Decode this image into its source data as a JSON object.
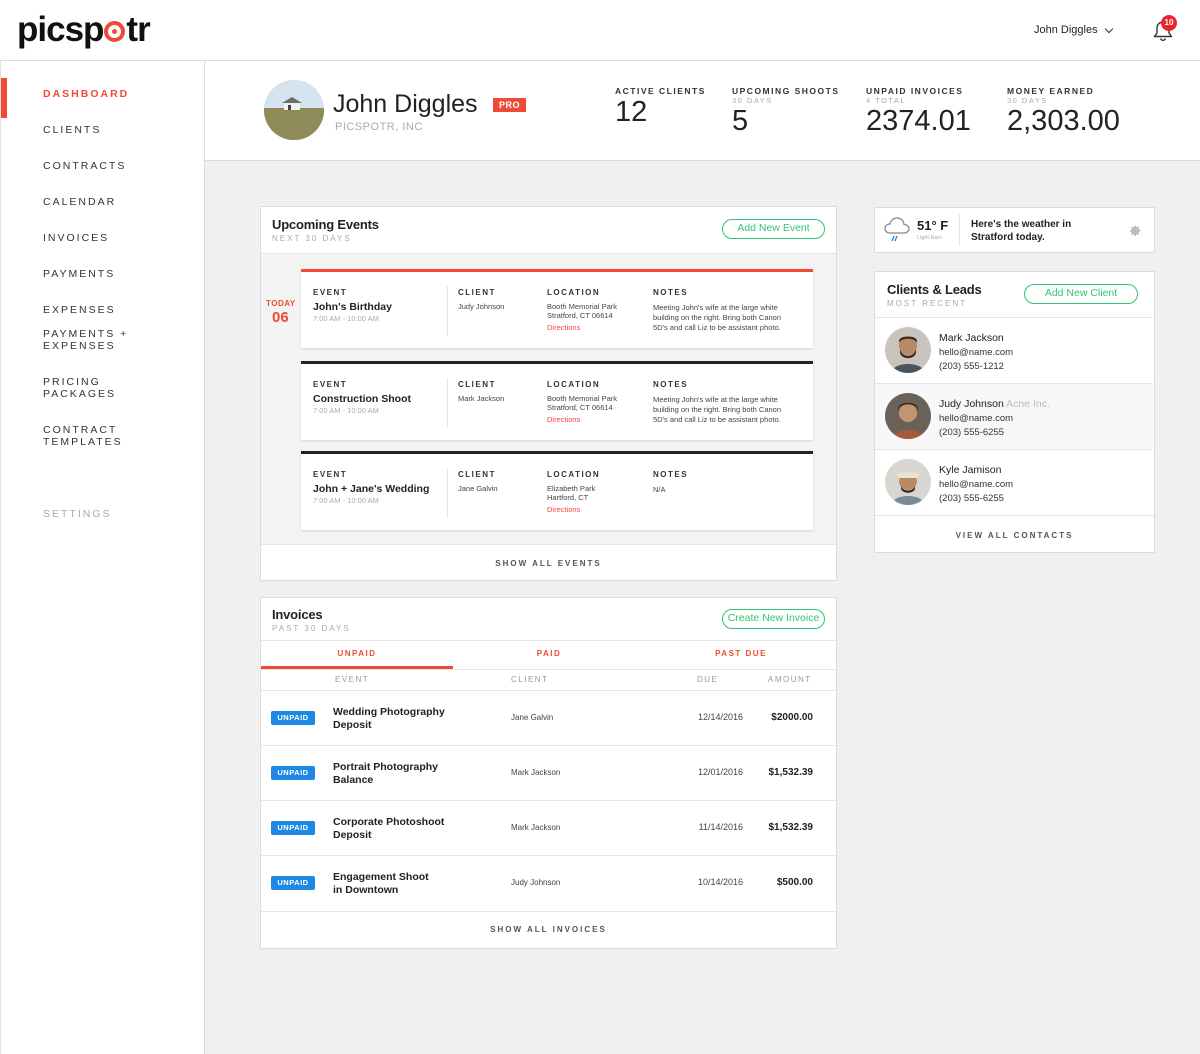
{
  "app": {
    "logo": {
      "pre": "picsp",
      "post": "tr"
    },
    "user_menu_label": "John Diggles",
    "notification_count": "10"
  },
  "colors": {
    "accent": "#ef4a36",
    "green": "#2ec76d",
    "unpaid_blue": "#1e88e5"
  },
  "sidebar": {
    "items": [
      {
        "label": "DASHBOARD",
        "active": true
      },
      {
        "label": "CLIENTS"
      },
      {
        "label": "CONTRACTS"
      },
      {
        "label": "CALENDAR"
      },
      {
        "label": "INVOICES"
      },
      {
        "label": "PAYMENTS"
      },
      {
        "label": "EXPENSES"
      },
      {
        "label_line1": "PAYMENTS +",
        "label_line2": "EXPENSES"
      },
      {
        "label_line1": "PRICING",
        "label_line2": "PACKAGES"
      },
      {
        "label_line1": "CONTRACT",
        "label_line2": "TEMPLATES"
      },
      {
        "label": "SETTINGS",
        "muted": true
      }
    ]
  },
  "profile": {
    "name": "John Diggles",
    "badge": "PRO",
    "company": "PICSPOTR, INC"
  },
  "stats": [
    {
      "label": "ACTIVE CLIENTS",
      "sub": "",
      "value": "12"
    },
    {
      "label": "UPCOMING SHOOTS",
      "sub": "30 DAYS",
      "value": "5"
    },
    {
      "label": "UNPAID INVOICES",
      "sub": "4 TOTAL",
      "value": "2374.01"
    },
    {
      "label": "MONEY EARNED",
      "sub": "30 DAYS",
      "value": "2,303.00"
    }
  ],
  "events": {
    "title": "Upcoming Events",
    "subtitle": "NEXT 30 DAYS",
    "add_button": "Add New Event",
    "today_label": "TODAY",
    "today_day": "06",
    "col_event": "EVENT",
    "col_client": "CLIENT",
    "col_location": "LOCATION",
    "col_notes": "NOTES",
    "items": [
      {
        "title": "John's Birthday",
        "time": "7:00 AM - 10:00 AM",
        "client": "Judy Johnson",
        "location_line1": "Booth Memorial Park",
        "location_line2": "Stratford, CT 06614",
        "directions": "Directions",
        "notes_line1": "Meeting John's wife at the large white",
        "notes_line2": "building on the right. Bring both Canon",
        "notes_line3": "5D's and call Liz to be assistant photo."
      },
      {
        "title": "Construction Shoot",
        "time": "7:00 AM - 10:00 AM",
        "client": "Mark Jackson",
        "location_line1": "Booth Memorial Park",
        "location_line2": "Stratford, CT 06614",
        "directions": "Directions",
        "notes_line1": "Meeting John's wife at the large white",
        "notes_line2": "building on the right. Bring both Canon",
        "notes_line3": "5D's and call Liz to be assistant photo."
      },
      {
        "title": "John + Jane's Wedding",
        "time": "7:00 AM - 10:00 AM",
        "client": "Jane Galvin",
        "location_line1": "Elizabeth Park",
        "location_line2": "Hartford, CT",
        "directions": "Directions",
        "notes_line1": "N/A",
        "notes_line2": "",
        "notes_line3": ""
      }
    ],
    "show_all": "SHOW ALL EVENTS"
  },
  "invoices": {
    "title": "Invoices",
    "subtitle": "PAST 30 DAYS",
    "create_button": "Create New Invoice",
    "tabs": [
      "UNPAID",
      "PAID",
      "PAST DUE"
    ],
    "headers": {
      "event": "EVENT",
      "client": "CLIENT",
      "due": "DUE",
      "amount": "AMOUNT"
    },
    "rows": [
      {
        "status": "UNPAID",
        "event_line1": "Wedding Photography",
        "event_line2": "Deposit",
        "client": "Jane Galvin",
        "due": "12/14/2016",
        "amount": "$2000.00"
      },
      {
        "status": "UNPAID",
        "event_line1": "Portrait Photography",
        "event_line2": "Balance",
        "client": "Mark Jackson",
        "due": "12/01/2016",
        "amount": "$1,532.39"
      },
      {
        "status": "UNPAID",
        "event_line1": "Corporate Photoshoot",
        "event_line2": "Deposit",
        "client": "Mark Jackson",
        "due": "11/14/2016",
        "amount": "$1,532.39"
      },
      {
        "status": "UNPAID",
        "event_line1": "Engagement Shoot",
        "event_line2": "in Downtown",
        "client": "Judy Johnson",
        "due": "10/14/2016",
        "amount": "$500.00"
      }
    ],
    "show_all": "SHOW ALL INVOICES"
  },
  "weather": {
    "temp": "51° F",
    "condition": "Light Rain",
    "message_line1": "Here's the weather in",
    "message_line2": "Stratford today.",
    "icon": "cloud-rain-icon"
  },
  "clients": {
    "title": "Clients & Leads",
    "subtitle": "MOST RECENT",
    "add_button": "Add New Client",
    "items": [
      {
        "name": "Mark Jackson",
        "company": "",
        "email": "hello@name.com",
        "phone": "(203) 555-1212"
      },
      {
        "name": "Judy Johnson",
        "company": "Acne Inc.",
        "email": "hello@name.com",
        "phone": "(203) 555-6255"
      },
      {
        "name": "Kyle Jamison",
        "company": "",
        "email": "hello@name.com",
        "phone": "(203) 555-6255"
      }
    ],
    "view_all": "VIEW ALL CONTACTS"
  }
}
